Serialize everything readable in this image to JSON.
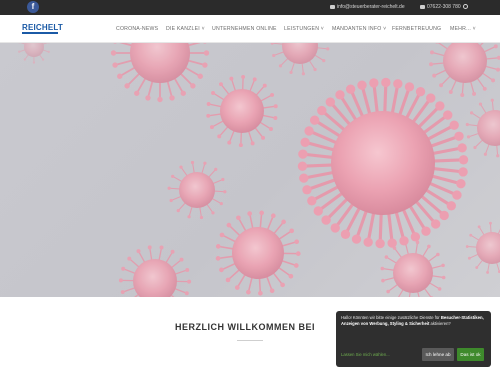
{
  "topbar": {
    "facebook_glyph": "f",
    "email": "info@steuerberater-reichelt.de",
    "phone": "07622-308 780"
  },
  "nav": {
    "logo": "REICHELT",
    "items": [
      "CORONA-NEWS",
      "DIE KANZLEI",
      "UNTERNEHMEN ONLINE",
      "LEISTUNGEN",
      "MANDANTEN INFO",
      "FERNBETREUUNG",
      "MEHR..."
    ]
  },
  "hero": {
    "image_alt": "Coronavirus"
  },
  "main": {
    "heading": "HERZLICH WILLKOMMEN BEI"
  },
  "cookie": {
    "text_before": "Hallo! Könnten wir bitte einige zusätzliche Dienste für ",
    "text_bold": "Besucher-Statistiken, Anzeigen von Werbung, Styling & Sicherheit",
    "text_after": " aktivieren?",
    "more_link": "Lassen Sie mich wählen...",
    "decline": "Ich lehne ab",
    "accept": "Das ist ok"
  }
}
